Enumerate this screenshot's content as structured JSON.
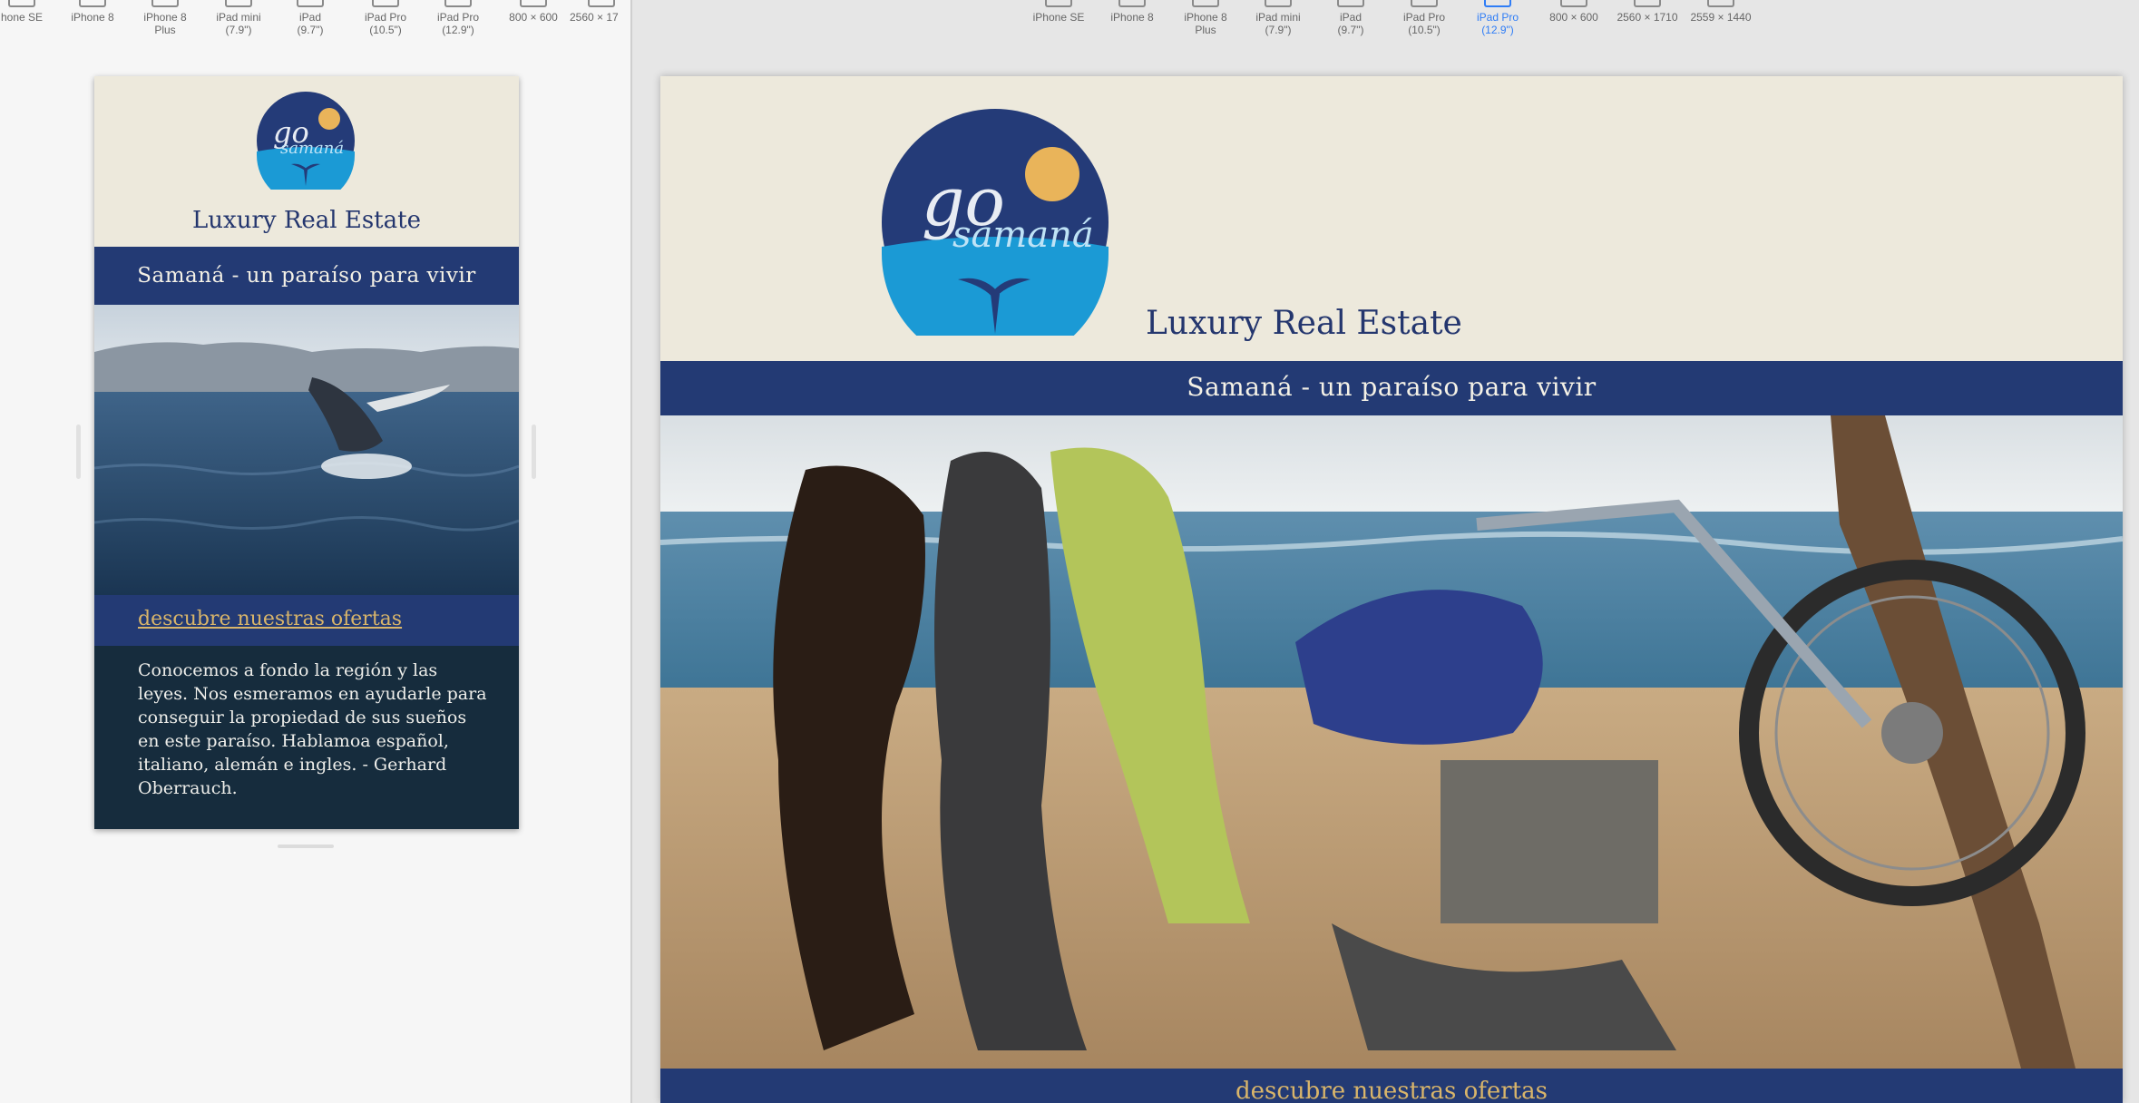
{
  "left_device_bar": {
    "devices": [
      {
        "label": "hone SE"
      },
      {
        "label": "iPhone 8"
      },
      {
        "label": "iPhone 8\nPlus"
      },
      {
        "label": "iPad mini\n(7.9\")"
      },
      {
        "label": "iPad\n(9.7\")"
      },
      {
        "label": "iPad Pro\n(10.5\")"
      },
      {
        "label": "iPad Pro\n(12.9\")"
      },
      {
        "label": "800 × 600"
      },
      {
        "label": "2560 × 17"
      }
    ]
  },
  "right_device_bar": {
    "devices": [
      {
        "label": "iPhone SE"
      },
      {
        "label": "iPhone 8"
      },
      {
        "label": "iPhone 8\nPlus"
      },
      {
        "label": "iPad mini\n(7.9\")"
      },
      {
        "label": "iPad\n(9.7\")"
      },
      {
        "label": "iPad Pro\n(10.5\")"
      },
      {
        "label": "iPad Pro\n(12.9\")",
        "active": true
      },
      {
        "label": "800 × 600"
      },
      {
        "label": "2560 × 1710"
      },
      {
        "label": "2559 × 1440"
      }
    ]
  },
  "site": {
    "logo_go": "go",
    "logo_samana": "samaná",
    "brand": "Luxury Real Estate",
    "tagline": "Samaná - un paraíso para vivir",
    "offers_link": "descubre nuestras ofertas",
    "about": "Conocemos a fondo la región y las leyes. Nos esmeramos en ayudarle para conseguir la propiedad de sus sueños en este paraíso. Hablamoa español, italiano, alemán e ingles. - Gerhard Oberrauch."
  },
  "colors": {
    "navy": "#233a74",
    "cream": "#ede9dc",
    "gold": "#d9b56a",
    "about_bg": "#162c3d",
    "active_device": "#2f7df6"
  }
}
